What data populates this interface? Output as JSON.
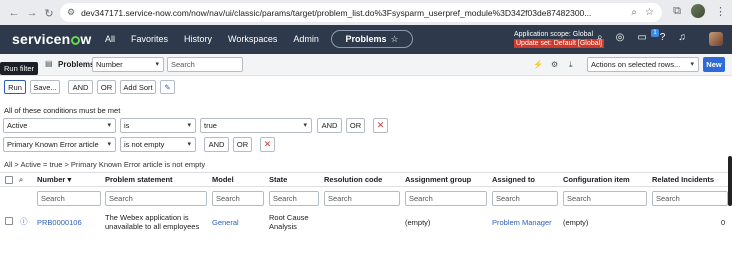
{
  "browser": {
    "url": "dev347171.service-now.com/now/nav/ui/classic/params/target/problem_list.do%3Fsysparm_userpref_module%3D342f03de87482300..."
  },
  "header": {
    "logo": "servicenow",
    "menu": [
      "All",
      "Favorites",
      "History",
      "Workspaces",
      "Admin"
    ],
    "context_pill": "Problems",
    "scope_line": "Application scope: Global",
    "update_set": "Update set: Default [Global]",
    "notification_count": "1"
  },
  "listbar": {
    "tooltip": "Run filter",
    "title": "Problems",
    "search_field": "Number",
    "search_placeholder": "Search",
    "actions_select": "Actions on selected rows...",
    "new_label": "New"
  },
  "filter": {
    "run_label": "Run",
    "save_label": "Save...",
    "and_label": "AND",
    "or_label": "OR",
    "add_sort_label": "Add Sort",
    "conditions_title": "All of these conditions must be met",
    "conditions": [
      {
        "field": "Active",
        "operator": "is",
        "value": "true"
      },
      {
        "field": "Primary Known Error article",
        "operator": "is not empty",
        "value": ""
      }
    ],
    "breadcrumb": "All > Active = true > Primary Known Error article is not empty"
  },
  "table": {
    "columns": [
      "Number",
      "Problem statement",
      "Model",
      "State",
      "Resolution code",
      "Assignment group",
      "Assigned to",
      "Configuration item",
      "Related Incidents"
    ],
    "search_placeholder": "Search",
    "rows": [
      {
        "number": "PRB0000106",
        "statement_line1": "The Webex application is",
        "statement_line2": "unavailable to all employees",
        "model": "General",
        "state_line1": "Root Cause",
        "state_line2": "Analysis",
        "resolution_code": "",
        "assignment_group": "(empty)",
        "assigned_to": "Problem Manager",
        "configuration_item": "(empty)",
        "related_incidents": "0"
      }
    ]
  },
  "colors": {
    "header_bg": "#2e3a4b",
    "primary": "#2e6bd8",
    "link": "#2e5fb8",
    "update_set_bg": "#d13a2a",
    "logo_accent": "#62d84e"
  }
}
